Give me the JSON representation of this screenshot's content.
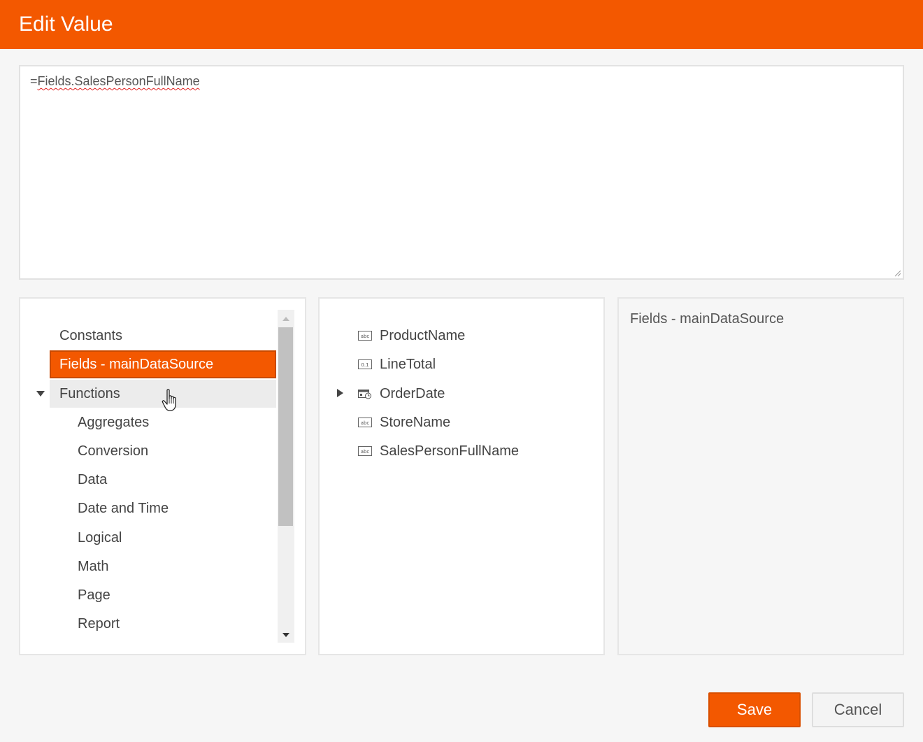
{
  "dialog": {
    "title": "Edit Value"
  },
  "editor": {
    "prefix": "=",
    "expression": "Fields.SalesPersonFullName"
  },
  "categories": {
    "items": [
      {
        "label": "Constants",
        "state": "normal"
      },
      {
        "label": "Fields - mainDataSource",
        "state": "selected"
      },
      {
        "label": "Functions",
        "state": "hover",
        "expanded": true
      }
    ],
    "function_items": [
      {
        "label": "Aggregates"
      },
      {
        "label": "Conversion"
      },
      {
        "label": "Data"
      },
      {
        "label": "Date and Time"
      },
      {
        "label": "Logical"
      },
      {
        "label": "Math"
      },
      {
        "label": "Page"
      },
      {
        "label": "Report"
      }
    ]
  },
  "fields": {
    "items": [
      {
        "label": "ProductName",
        "icon": "text-field-icon"
      },
      {
        "label": "LineTotal",
        "icon": "number-field-icon"
      },
      {
        "label": "OrderDate",
        "icon": "date-field-icon",
        "expandable": true
      },
      {
        "label": "StoreName",
        "icon": "text-field-icon"
      },
      {
        "label": "SalesPersonFullName",
        "icon": "text-field-icon"
      }
    ]
  },
  "description": {
    "text": "Fields - mainDataSource"
  },
  "buttons": {
    "save": "Save",
    "cancel": "Cancel"
  },
  "colors": {
    "accent": "#f35800",
    "panel_bg": "#f6f6f6",
    "hover_bg": "#ececec"
  }
}
